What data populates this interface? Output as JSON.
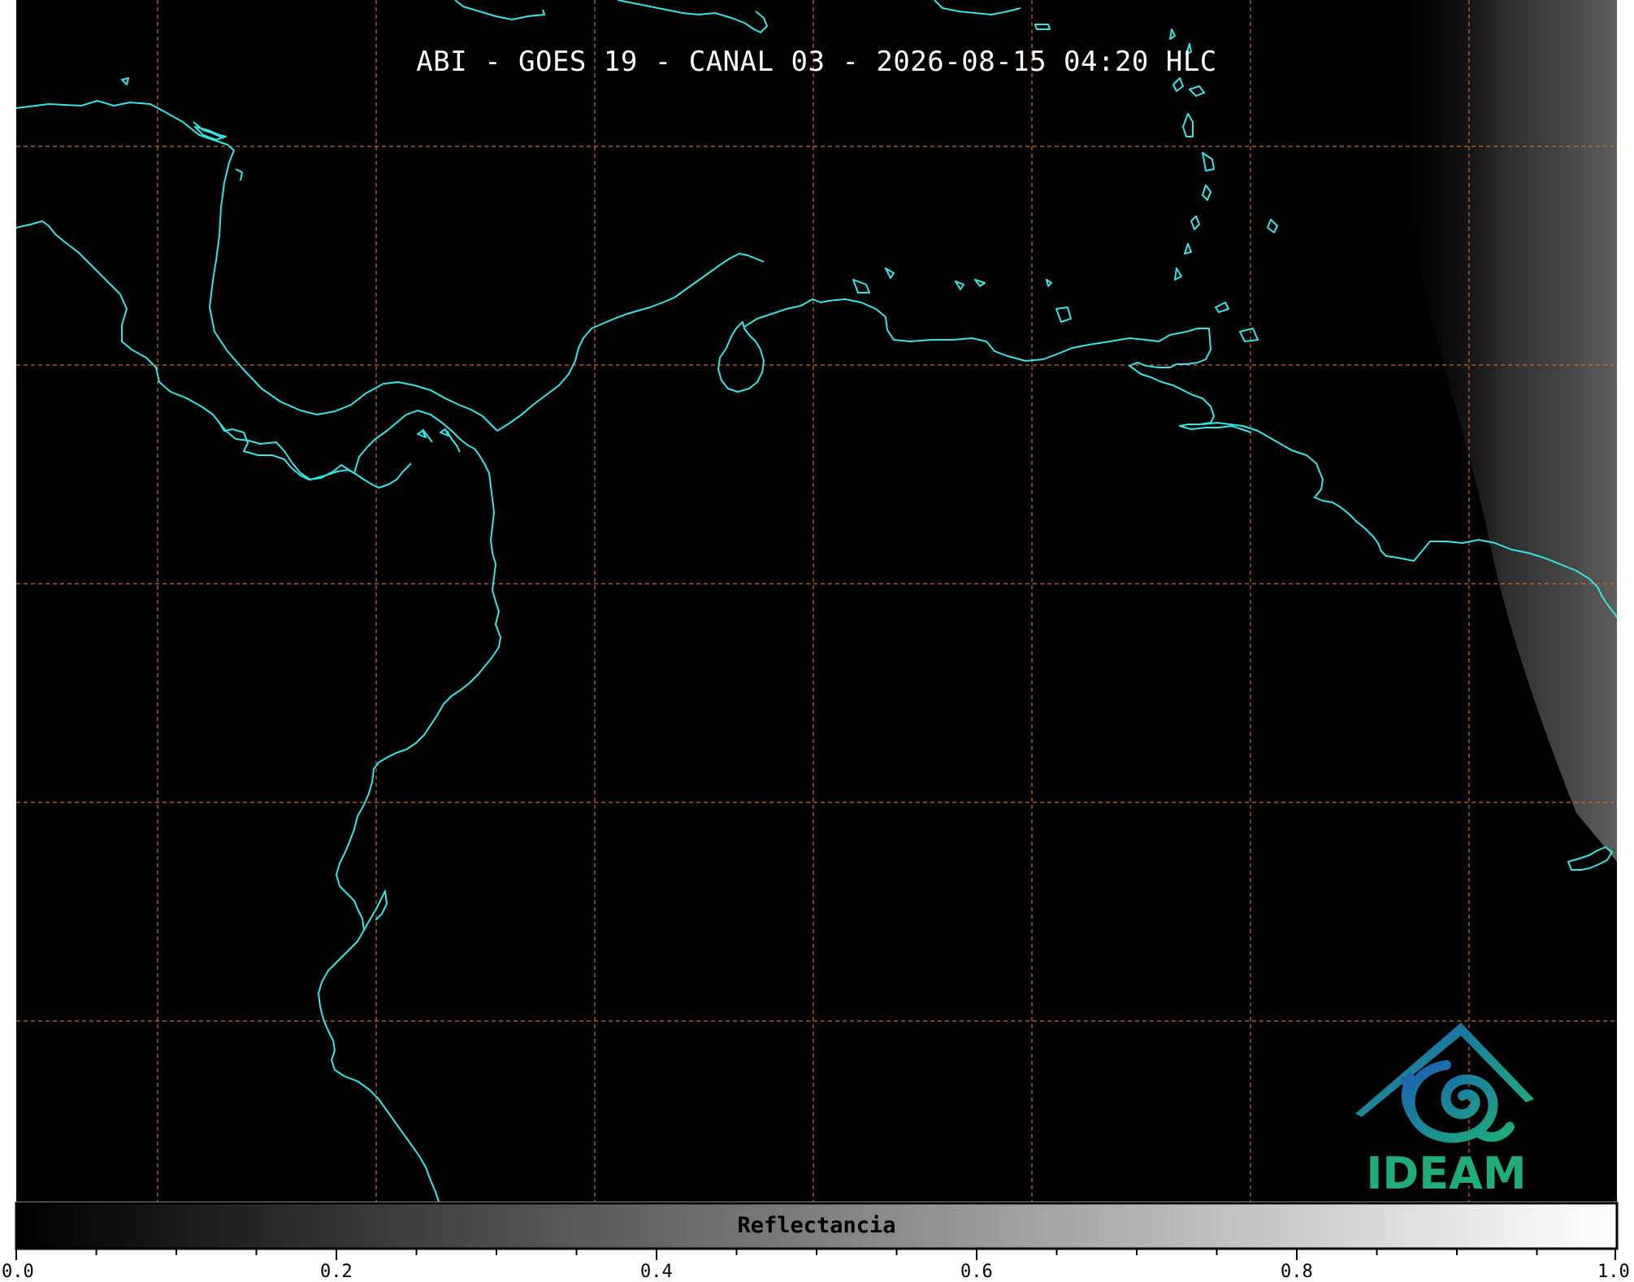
{
  "map": {
    "title": "ABI - GOES 19 - CANAL 03 - 2026-08-15 04:20 HLC",
    "background_color": "#000000",
    "coastline_color": "#33e6e6",
    "gridline_color": "#d2692a",
    "gridline_style": "dashed",
    "logo": {
      "text": "IDEAM",
      "icon": "ideam-mountain-swirl-logo",
      "colors": [
        "#1a5fb4",
        "#1fae7b"
      ]
    }
  },
  "colorbar": {
    "label": "Reflectancia",
    "colormap": "grayscale",
    "min": 0.0,
    "max": 1.0,
    "tick_labels": [
      "0.0",
      "0.2",
      "0.4",
      "0.6",
      "0.8",
      "1.0"
    ]
  }
}
